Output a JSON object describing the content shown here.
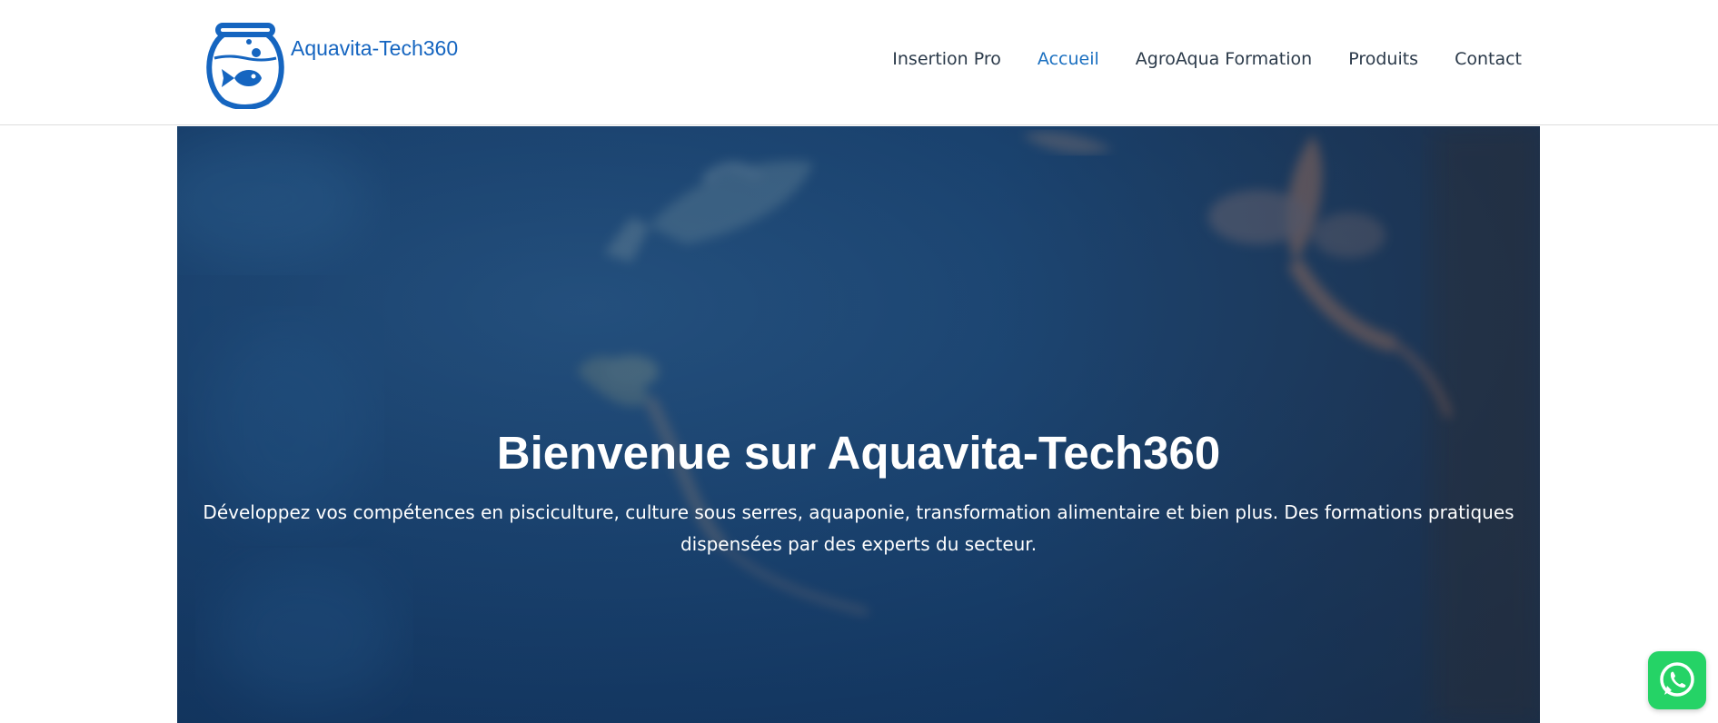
{
  "brand": {
    "name": "Aquavita-Tech360",
    "logo_icon": "fishbowl-icon",
    "color": "#1565c0"
  },
  "nav": {
    "items": [
      {
        "label": "Insertion Pro",
        "active": false
      },
      {
        "label": "Accueil",
        "active": true
      },
      {
        "label": "AgroAqua Formation",
        "active": false
      },
      {
        "label": "Produits",
        "active": false
      },
      {
        "label": "Contact",
        "active": false
      }
    ],
    "active_color": "#1a6fc0",
    "text_color": "#2b3a4a"
  },
  "hero": {
    "title": "Bienvenue sur Aquavita-Tech360",
    "subtitle": "Développez vos compétences en pisciculture, culture sous serres, aquaponie, transformation alimentaire et bien plus. Des formations pratiques dispensées par des experts du secteur.",
    "background": "aquarium-fish-photo"
  },
  "floating": {
    "whatsapp_icon": "whatsapp-icon",
    "color": "#25d366"
  }
}
